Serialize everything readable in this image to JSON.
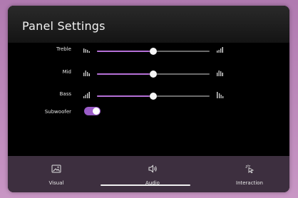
{
  "panel": {
    "title": "Panel Settings"
  },
  "sliders": [
    {
      "label": "Treble",
      "value": 0.5,
      "low_icon": "low-treble-icon",
      "high_icon": "high-treble-icon"
    },
    {
      "label": "Mid",
      "value": 0.5,
      "low_icon": "low-mid-icon",
      "high_icon": "high-mid-icon"
    },
    {
      "label": "Bass",
      "value": 0.5,
      "low_icon": "low-bass-icon",
      "high_icon": "high-bass-icon"
    }
  ],
  "subwoofer": {
    "label": "Subwoofer",
    "enabled": true
  },
  "nav": {
    "items": [
      {
        "label": "Visual",
        "icon": "image-icon",
        "active": false
      },
      {
        "label": "Audio",
        "icon": "speaker-icon",
        "active": true
      },
      {
        "label": "Interaction",
        "icon": "pointer-icon",
        "active": false
      }
    ]
  },
  "colors": {
    "accent": "#b56fd6",
    "toggle_on": "#9a5cc8",
    "nav_bg": "#3d2f3f",
    "panel_bg": "#000000",
    "frame": "#c58fc0"
  }
}
